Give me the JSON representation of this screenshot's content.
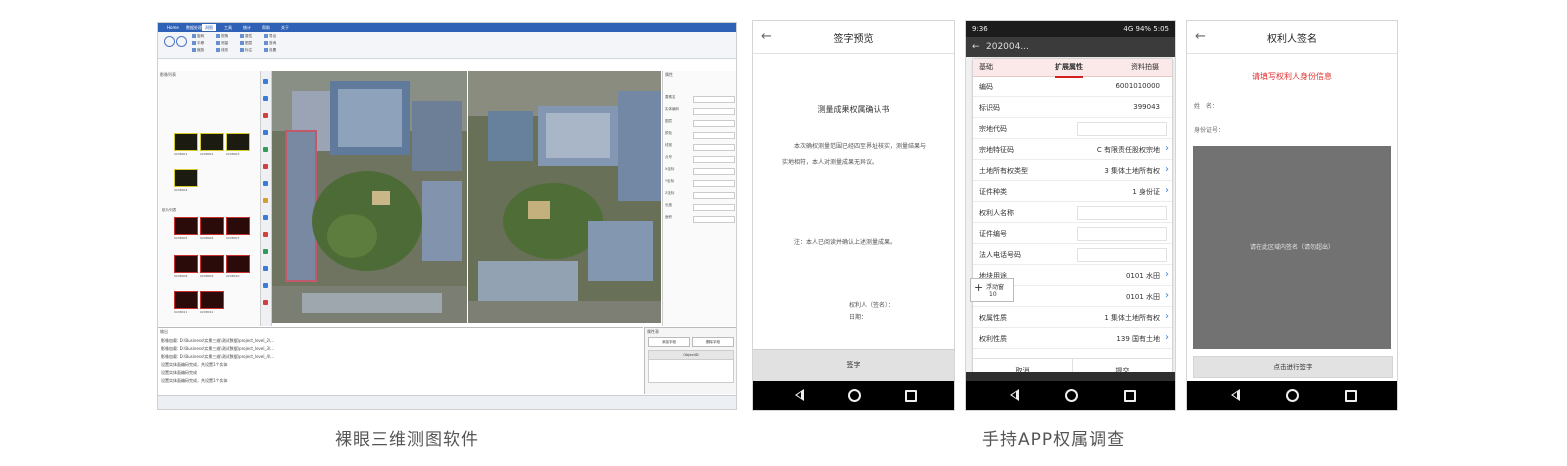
{
  "desktop": {
    "menu_tabs": [
      "Home",
      "数据处理",
      "测图",
      "工具",
      "统计",
      "帮助",
      "关于"
    ],
    "active_tab_index": 2,
    "ribbon_items": [
      "旋转",
      "平移",
      "缩放",
      "视角",
      "测量",
      "线形",
      "属性",
      "图层",
      "标注",
      "导出",
      "查询",
      "设置"
    ],
    "left_panel_title": "影像列表",
    "section_label": "航片列表",
    "thumb_labels": [
      "0208001",
      "0208002",
      "0208003",
      "0208004",
      "0208005",
      "0208006",
      "0208007",
      "0208008",
      "0208009",
      "0208010",
      "0208011",
      "0208012"
    ],
    "prop_title": "属性",
    "prop_rows": [
      "要素名",
      "实体编码",
      "图层",
      "颜色",
      "线宽",
      "点号",
      "X坐标",
      "Y坐标",
      "Z坐标",
      "长度",
      "面积"
    ],
    "log_title": "输出",
    "log_lines": [
      "影像加载: D:\\Business\\实景三维\\测试数据\\project_level_2\\...",
      "影像加载: D:\\Business\\实景三维\\测试数据\\project_level_3\\...",
      "影像加载: D:\\Business\\实景三维\\测试数据\\project_level_4\\...",
      "设置实体面编码完成，共设置1个实体",
      "设置实体面编码完成",
      "设置实体面编码完成，共设置1个实体"
    ],
    "small_panel_title": "属性表",
    "small_buttons": [
      "添加字段",
      "删除字段"
    ],
    "small_header": "ObjectID"
  },
  "phone1": {
    "title": "签字预览",
    "doc_title": "测量成果权属确认书",
    "paragraphs": [
      "本次确权测量范围已经四至界址核实，测量结果与实地相符，本人对测量成果无异议。",
      "注：本人已阅读并确认上述测量成果。"
    ],
    "sign_lines": [
      "权利人（签名）：",
      "日期："
    ],
    "button": "签字"
  },
  "phone2": {
    "status_left": "9:36",
    "status_right": "4G  94%  5:05",
    "header_title": "202004...",
    "tabs": [
      "基础",
      "扩展属性",
      "资料拍摄"
    ],
    "active_tab_index": 1,
    "rows": [
      {
        "label": "编码",
        "value": "6001010000",
        "input": false,
        "chevron": false
      },
      {
        "label": "标识码",
        "value": "399043",
        "input": false,
        "chevron": false
      },
      {
        "label": "宗地代码",
        "value": "",
        "input": true,
        "chevron": false
      },
      {
        "label": "宗地特征码",
        "value": "C 有限责任股权宗地",
        "input": false,
        "chevron": true
      },
      {
        "label": "土地所有权类型",
        "value": "3 集体土地所有权",
        "input": false,
        "chevron": true
      },
      {
        "label": "证件种类",
        "value": "1 身份证",
        "input": false,
        "chevron": true
      },
      {
        "label": "权利人名称",
        "value": "",
        "input": true,
        "chevron": false
      },
      {
        "label": "证件编号",
        "value": "",
        "input": true,
        "chevron": false
      },
      {
        "label": "法人电话号码",
        "value": "",
        "input": true,
        "chevron": false
      },
      {
        "label": "地块用途",
        "value": "0101 水田",
        "input": false,
        "chevron": true
      },
      {
        "label": "实际用途",
        "value": "0101 水田",
        "input": false,
        "chevron": true
      },
      {
        "label": "权属性质",
        "value": "1 集体土地所有权",
        "input": false,
        "chevron": true
      },
      {
        "label": "权利性质",
        "value": "139 国有土地",
        "input": false,
        "chevron": true
      }
    ],
    "float_lines": [
      "浮动窗",
      "10"
    ],
    "footer_buttons": [
      "取消",
      "提交"
    ]
  },
  "phone3": {
    "title": "权利人签名",
    "hint": "请填写权利人身份信息",
    "fields": [
      "姓　名：",
      "身份证号："
    ],
    "sig_hint": "请在此区域内签名（请勿超出）",
    "button": "点击进行签字"
  },
  "captions": {
    "left": "裸眼三维测图软件",
    "right": "手持APP权属调查"
  }
}
